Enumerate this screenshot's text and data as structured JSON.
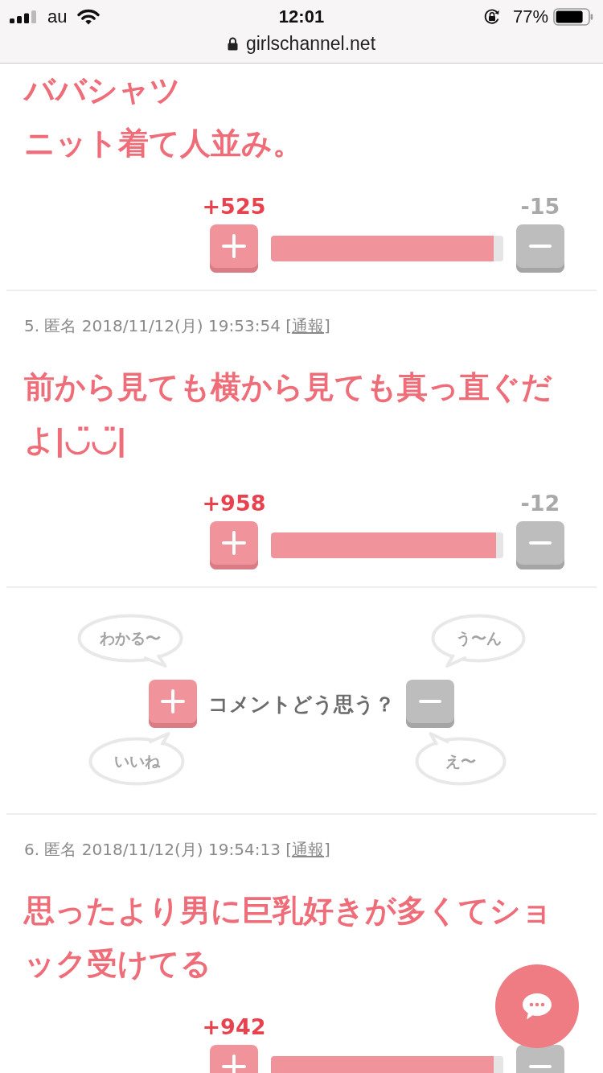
{
  "status_bar": {
    "carrier": "au",
    "time": "12:01",
    "battery": "77%"
  },
  "address_bar": {
    "url": "girlschannel.net"
  },
  "feed": [
    {
      "kind": "comment",
      "paragraphs": [
        "ババシャツ",
        "ニット着て人並み。"
      ],
      "votes": {
        "plus": "+525",
        "minus": "-15",
        "level": 0.96
      }
    },
    {
      "kind": "comment",
      "meta": {
        "text": "5. 匿名 2018/11/12(月) 19:53:54",
        "open": "[",
        "report": "通報",
        "close": "]"
      },
      "paragraphs": [
        "前から見ても横から見ても真っ直ぐだよ|◡̈◡̈|"
      ],
      "votes": {
        "plus": "+958",
        "minus": "-12",
        "level": 0.97
      }
    },
    {
      "kind": "reaction_prompt",
      "question": "コメントどう思う？",
      "agree_bubbles": [
        "わかる〜",
        "いいね"
      ],
      "disagree_bubbles": [
        "う〜ん",
        "え〜"
      ]
    },
    {
      "kind": "comment",
      "meta": {
        "text": "6. 匿名 2018/11/12(月) 19:54:13",
        "open": "[",
        "report": "通報",
        "close": "]"
      },
      "paragraphs": [
        "思ったより男に巨乳好きが多くてショック受けてる"
      ],
      "votes": {
        "plus": "+942",
        "level": 0.96
      }
    }
  ]
}
